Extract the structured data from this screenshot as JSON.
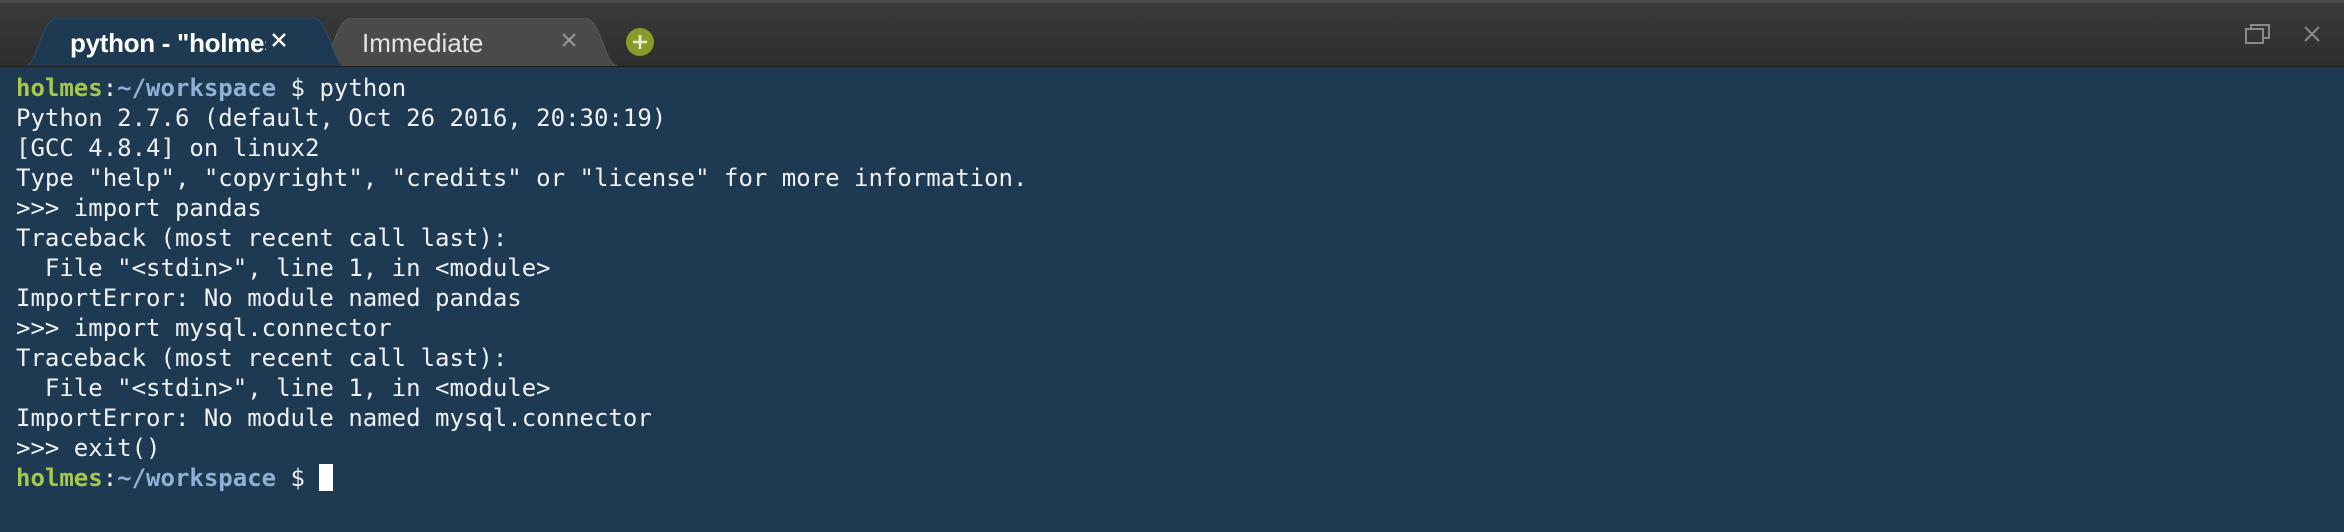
{
  "tabs": [
    {
      "label": "python - \"holmes",
      "active": true
    },
    {
      "label": "Immediate",
      "active": false
    }
  ],
  "icons": {
    "tab_close": "close-icon",
    "add_tab": "plus-circle-icon",
    "window_restore": "restore-window-icon",
    "window_close": "close-window-icon"
  },
  "colors": {
    "terminal_bg": "#1e3a52",
    "prompt_user": "#a7c94a",
    "prompt_path": "#8fb1d8",
    "add_button": "#8a9a2a"
  },
  "terminal": {
    "prompt": {
      "user": "holmes",
      "sep": ":",
      "path": "~/workspace",
      "dollar": " $ "
    },
    "first_command": "python",
    "output": [
      "Python 2.7.6 (default, Oct 26 2016, 20:30:19)",
      "[GCC 4.8.4] on linux2",
      "Type \"help\", \"copyright\", \"credits\" or \"license\" for more information.",
      ">>> import pandas",
      "Traceback (most recent call last):",
      "  File \"<stdin>\", line 1, in <module>",
      "ImportError: No module named pandas",
      ">>> import mysql.connector",
      "Traceback (most recent call last):",
      "  File \"<stdin>\", line 1, in <module>",
      "ImportError: No module named mysql.connector",
      ">>> exit()"
    ]
  }
}
